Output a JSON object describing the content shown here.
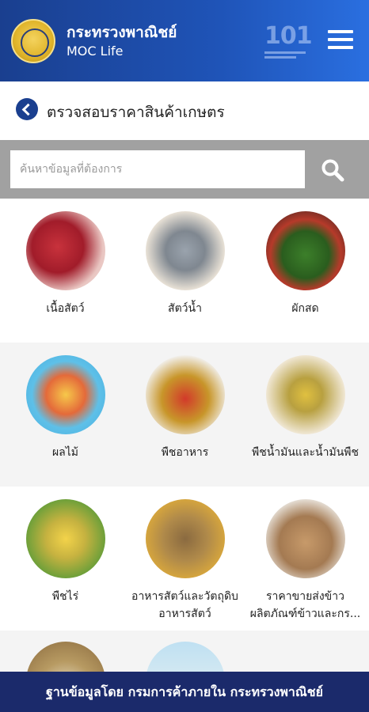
{
  "header": {
    "app_title": "กระทรวงพาณิชย์",
    "app_subtitle": "MOC Life",
    "badge_text": "101",
    "icons": {
      "logo": "moc-seal-logo",
      "badge": "101-badge-icon",
      "menu": "hamburger-menu-icon"
    }
  },
  "page": {
    "title": "ตรวจสอบราคาสินค้าเกษตร",
    "back_icon": "back-arrow-icon"
  },
  "search": {
    "placeholder": "ค้นหาข้อมูลที่ต้องการ",
    "value": "",
    "icon": "search-icon"
  },
  "categories": [
    {
      "label": "เนื้อสัตว์",
      "image": "meat"
    },
    {
      "label": "สัตว์น้ำ",
      "image": "fish"
    },
    {
      "label": "ผักสด",
      "image": "vegetables"
    },
    {
      "label": "ผลไม้",
      "image": "fruits"
    },
    {
      "label": "พืชอาหาร",
      "image": "food-crops"
    },
    {
      "label": "พืชน้ำมันและน้ำมันพืช",
      "image": "oil-crops"
    },
    {
      "label": "พืชไร่",
      "image": "field-crops"
    },
    {
      "label": "อาหารสัตว์และวัตถุดิบ",
      "label_2": "อาหารสัตว์",
      "image": "animal-feed"
    },
    {
      "label": "ราคาขายส่งข้าว",
      "label_2": "ผลิตภัณฑ์ข้าวและกร...",
      "image": "rice-wholesale"
    },
    {
      "label": "",
      "image": "grain"
    },
    {
      "label": "",
      "image": "farm-field"
    }
  ],
  "footer": {
    "text": "ฐานข้อมูลโดย กรมการค้าภายใน กระทรวงพาณิชย์"
  },
  "colors": {
    "header_gradient_start": "#1a3f8f",
    "header_gradient_end": "#2a6fe0",
    "search_bar_bg": "#a1a1a1",
    "alt_row_bg": "#f4f4f4",
    "footer_bg": "#1b2a6b"
  }
}
